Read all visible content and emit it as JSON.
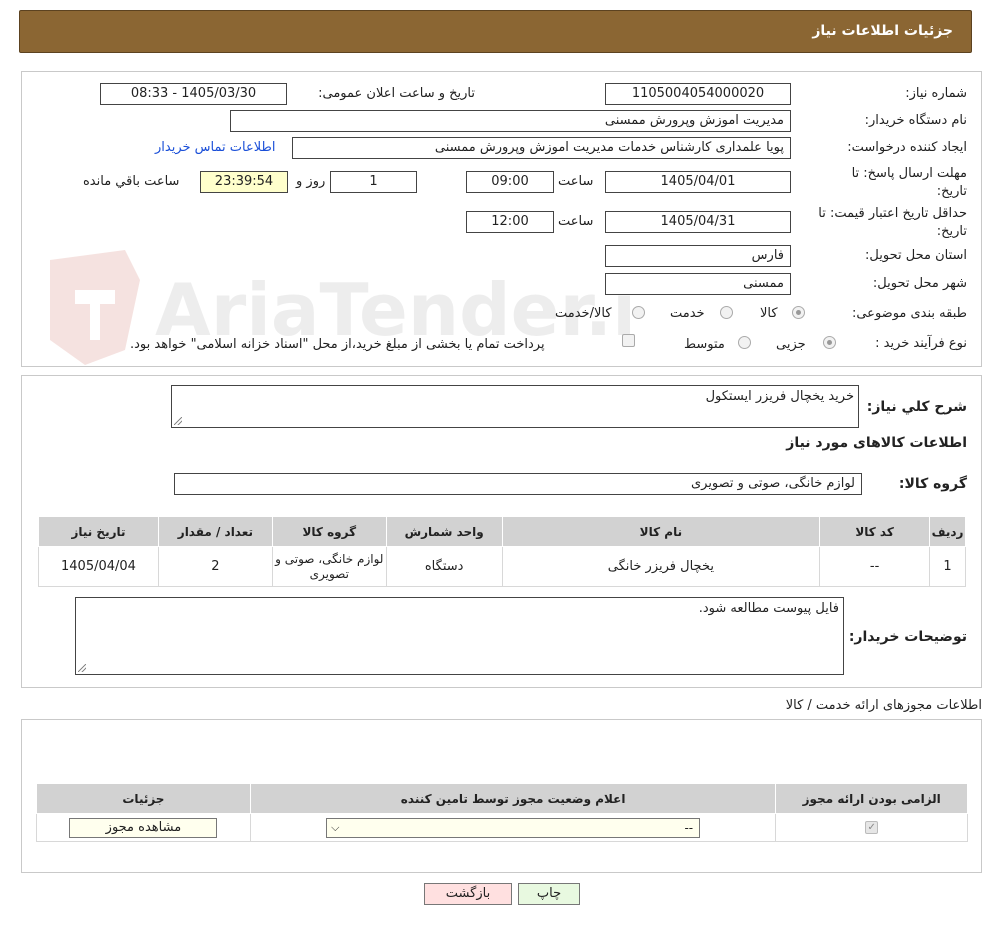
{
  "header": {
    "title": "جزئیات اطلاعات نیاز"
  },
  "form": {
    "need_number_label": "شماره نیاز:",
    "need_number": "1105004054000020",
    "announce_label": "تاریخ و ساعت اعلان عمومی:",
    "announce_value": "1405/03/30 - 08:33",
    "buyer_org_label": "نام دستگاه خریدار:",
    "buyer_org": "مدیریت اموزش وپرورش ممسنی",
    "creator_label": "ایجاد کننده درخواست:",
    "creator": "پویا علمداری کارشناس خدمات مدیریت اموزش وپرورش ممسنی",
    "contact_link": "اطلاعات تماس خریدار",
    "reply_deadline_label_1": "مهلت ارسال پاسخ: تا",
    "reply_deadline_label_2": "تاریخ:",
    "reply_date": "1405/04/01",
    "time_label": "ساعت",
    "reply_time": "09:00",
    "days": "1",
    "days_label": "روز و",
    "remaining": "23:39:54",
    "remaining_label": "ساعت باقي مانده",
    "price_valid_label_1": "حداقل تاریخ اعتبار قیمت: تا",
    "price_valid_label_2": "تاریخ:",
    "price_valid_date": "1405/04/31",
    "price_valid_time": "12:00",
    "province_label": "استان محل تحویل:",
    "province": "فارس",
    "city_label": "شهر محل تحویل:",
    "city": "ممسنی",
    "category_label": "طبقه بندی موضوعی:",
    "category_options": [
      "کالا",
      "خدمت",
      "کالا/خدمت"
    ],
    "process_label": "نوع فرآیند خرید :",
    "process_options": [
      "جزیی",
      "متوسط"
    ],
    "treasury_note": "پرداخت تمام یا بخشی از مبلغ خرید،از محل \"اسناد خزانه اسلامی\" خواهد بود."
  },
  "details": {
    "summary_label": "شرح کلي نیاز:",
    "summary": "خرید یخچال فریزر ایستکول",
    "goods_info_title": "اطلاعات کالاهای مورد نیاز",
    "goods_group_label": "گروه کالا:",
    "goods_group": "لوازم خانگی، صوتی و تصویری",
    "table": {
      "headers": [
        "ردیف",
        "کد کالا",
        "نام کالا",
        "واحد شمارش",
        "گروه کالا",
        "تعداد / مقدار",
        "تاریخ نیاز"
      ],
      "rows": [
        [
          "1",
          "--",
          "یخچال فریزر خانگی",
          "دستگاه",
          "لوازم خانگی، صوتی و تصویری",
          "2",
          "1405/04/04"
        ]
      ]
    },
    "buyer_notes_label": "توضیحات خریدار:",
    "buyer_notes": "فایل پیوست مطالعه شود."
  },
  "permits": {
    "title": "اطلاعات مجوزهای ارائه خدمت / کالا",
    "headers": [
      "الزامی بودن ارائه مجوز",
      "اعلام وضعیت مجوز توسط تامین کننده",
      "جزئیات"
    ],
    "select_value": "--",
    "view_button": "مشاهده مجوز"
  },
  "actions": {
    "print": "چاپ",
    "back": "بازگشت"
  },
  "watermark": {
    "text": "AriaTender.neT"
  }
}
